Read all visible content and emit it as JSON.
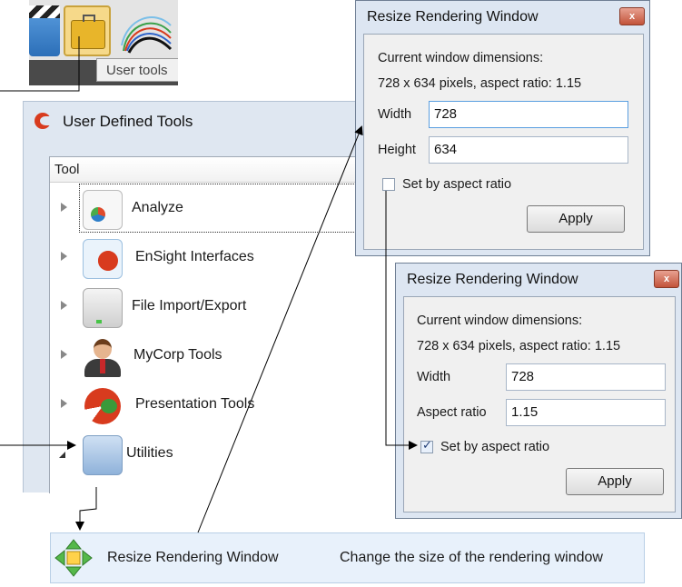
{
  "toolbar": {
    "tooltip": "User tools",
    "icons": [
      "film-icon",
      "toolbox-icon",
      "curves-icon"
    ]
  },
  "user_defined_tools": {
    "title": "User Defined Tools",
    "column_header": "Tool",
    "items": [
      {
        "label": "Analyze",
        "icon": "chart-document-icon",
        "expanded": false,
        "selected": true
      },
      {
        "label": "EnSight Interfaces",
        "icon": "ensight-icon",
        "expanded": false
      },
      {
        "label": "File Import/Export",
        "icon": "drive-icon",
        "expanded": false
      },
      {
        "label": "MyCorp Tools",
        "icon": "person-icon",
        "expanded": false
      },
      {
        "label": "Presentation Tools",
        "icon": "presentation-icon",
        "expanded": false
      },
      {
        "label": "Utilities",
        "icon": "folder-icon",
        "expanded": true
      }
    ]
  },
  "resize_dialog_1": {
    "title": "Resize Rendering Window",
    "close": "x",
    "current_label": "Current window dimensions:",
    "dimensions": "728 x 634 pixels, aspect ratio: 1.15",
    "width_label": "Width",
    "width_value": "728",
    "height_label": "Height",
    "height_value": "634",
    "checkbox_label": "Set by aspect ratio",
    "checked": false,
    "apply": "Apply"
  },
  "resize_dialog_2": {
    "title": "Resize Rendering Window",
    "close": "x",
    "current_label": "Current window dimensions:",
    "dimensions": "728 x 634 pixels, aspect ratio: 1.15",
    "width_label": "Width",
    "width_value": "728",
    "aspect_label": "Aspect ratio",
    "aspect_value": "1.15",
    "checkbox_label": "Set by aspect ratio",
    "checked": true,
    "apply": "Apply"
  },
  "utility_item": {
    "name": "Resize Rendering Window",
    "description": "Change the size of the rendering window",
    "icon": "move-arrows-icon"
  },
  "colors": {
    "window_frame": "#dfe7f1",
    "dialog_frame": "#dde6f2",
    "close_button": "#c2533a",
    "selection_bar": "#e8f1fb"
  }
}
